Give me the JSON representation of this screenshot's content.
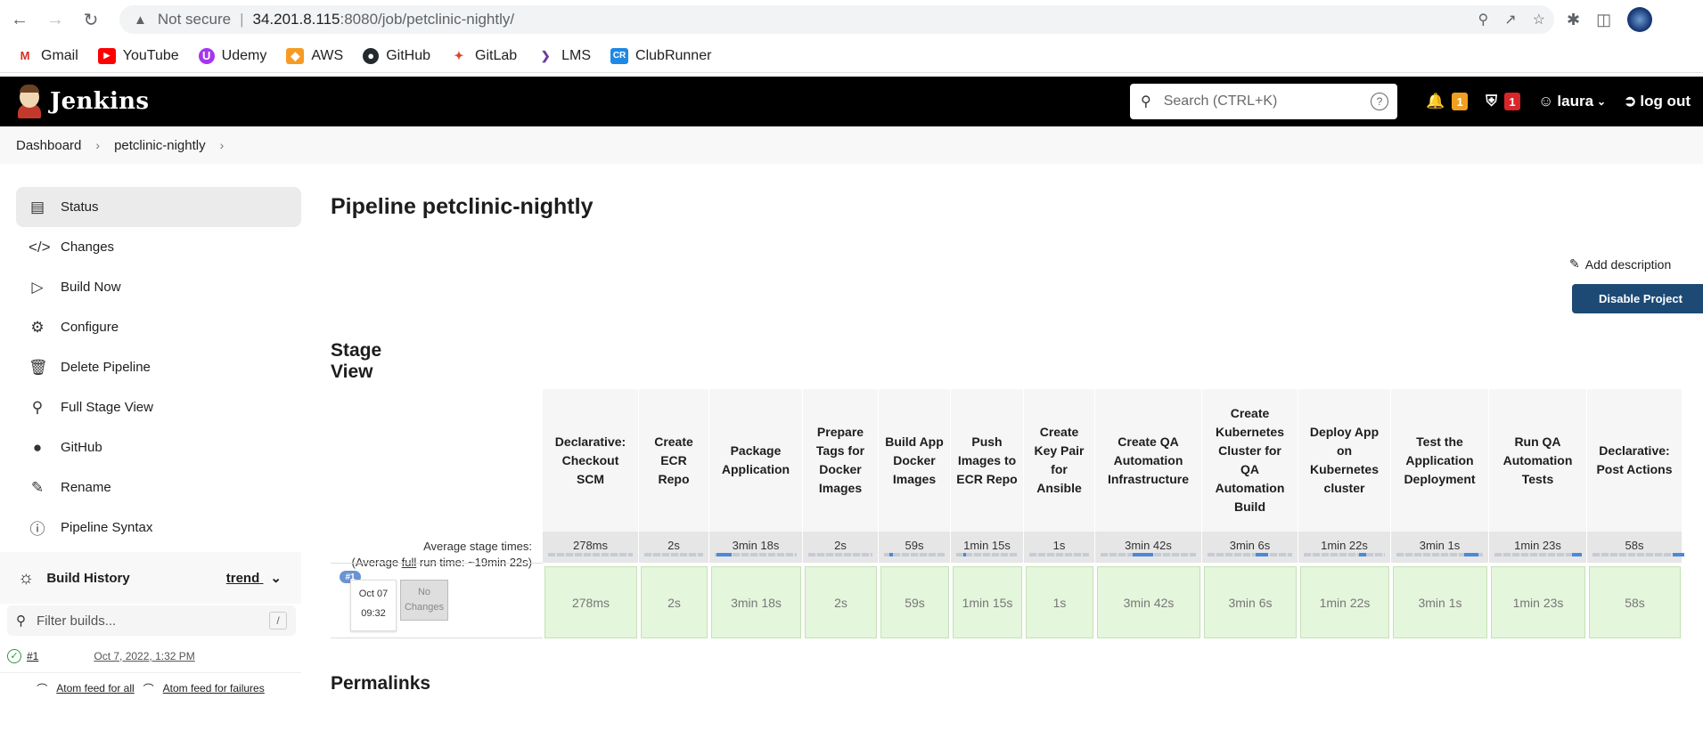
{
  "browser": {
    "not_secure": "Not secure",
    "url_host": "34.201.8.115",
    "url_rest": ":8080/job/petclinic-nightly/",
    "bookmarks": [
      {
        "label": "Gmail",
        "icon": "gmail-icon"
      },
      {
        "label": "YouTube",
        "icon": "youtube-icon"
      },
      {
        "label": "Udemy",
        "icon": "udemy-icon"
      },
      {
        "label": "AWS",
        "icon": "aws-icon"
      },
      {
        "label": "GitHub",
        "icon": "github-icon"
      },
      {
        "label": "GitLab",
        "icon": "gitlab-icon"
      },
      {
        "label": "LMS",
        "icon": "lms-icon"
      },
      {
        "label": "ClubRunner",
        "icon": "clubrunner-icon"
      }
    ]
  },
  "header": {
    "title": "Jenkins",
    "search_placeholder": "Search (CTRL+K)",
    "notifications_count": "1",
    "security_count": "1",
    "user": "laura",
    "logout": "log out"
  },
  "breadcrumb": [
    "Dashboard",
    "petclinic-nightly"
  ],
  "sidebar": {
    "items": [
      {
        "label": "Status",
        "icon": "status-icon",
        "active": true
      },
      {
        "label": "Changes",
        "icon": "code-icon"
      },
      {
        "label": "Build Now",
        "icon": "play-icon"
      },
      {
        "label": "Configure",
        "icon": "gear-icon"
      },
      {
        "label": "Delete Pipeline",
        "icon": "trash-icon"
      },
      {
        "label": "Full Stage View",
        "icon": "search-icon"
      },
      {
        "label": "GitHub",
        "icon": "github-icon"
      },
      {
        "label": "Rename",
        "icon": "pencil-icon"
      },
      {
        "label": "Pipeline Syntax",
        "icon": "help-icon"
      }
    ],
    "build_history": {
      "title": "Build History",
      "trend": "trend",
      "filter_placeholder": "Filter builds...",
      "filter_key": "/",
      "builds": [
        {
          "number": "#1",
          "date": "Oct 7, 2022, 1:32 PM",
          "status": "success"
        }
      ],
      "atom_all": "Atom feed for all",
      "atom_failures": "Atom feed for failures"
    }
  },
  "main": {
    "title": "Pipeline petclinic-nightly",
    "add_description": "Add description",
    "disable_button": "Disable Project",
    "stage_view_title": "Stage View",
    "permalinks_title": "Permalinks",
    "avg_stage_times": "Average stage times:",
    "avg_run_prefix": "(Average ",
    "avg_run_full": "full",
    "avg_run_suffix": " run time: ~19min 22s)",
    "run": {
      "badge": "#1",
      "month_day": "Oct 07",
      "time": "09:32",
      "changes": "No Changes"
    },
    "stages": [
      {
        "name": "Declarative: Checkout SCM",
        "avg": "278ms",
        "duration": "278ms"
      },
      {
        "name": "Create ECR Repo",
        "avg": "2s",
        "duration": "2s"
      },
      {
        "name": "Package Application",
        "avg": "3min 18s",
        "duration": "3min 18s"
      },
      {
        "name": "Prepare Tags for Docker Images",
        "avg": "2s",
        "duration": "2s"
      },
      {
        "name": "Build App Docker Images",
        "avg": "59s",
        "duration": "59s"
      },
      {
        "name": "Push Images to ECR Repo",
        "avg": "1min 15s",
        "duration": "1min 15s"
      },
      {
        "name": "Create Key Pair for Ansible",
        "avg": "1s",
        "duration": "1s"
      },
      {
        "name": "Create QA Automation Infrastructure",
        "avg": "3min 42s",
        "duration": "3min 42s"
      },
      {
        "name": "Create Kubernetes Cluster for QA Automation Build",
        "avg": "3min 6s",
        "duration": "3min 6s"
      },
      {
        "name": "Deploy App on Kubernetes cluster",
        "avg": "1min 22s",
        "duration": "1min 22s"
      },
      {
        "name": "Test the Application Deployment",
        "avg": "3min 1s",
        "duration": "3min 1s"
      },
      {
        "name": "Run QA Automation Tests",
        "avg": "1min 23s",
        "duration": "1min 23s"
      },
      {
        "name": "Declarative: Post Actions",
        "avg": "58s",
        "duration": "58s"
      }
    ]
  }
}
